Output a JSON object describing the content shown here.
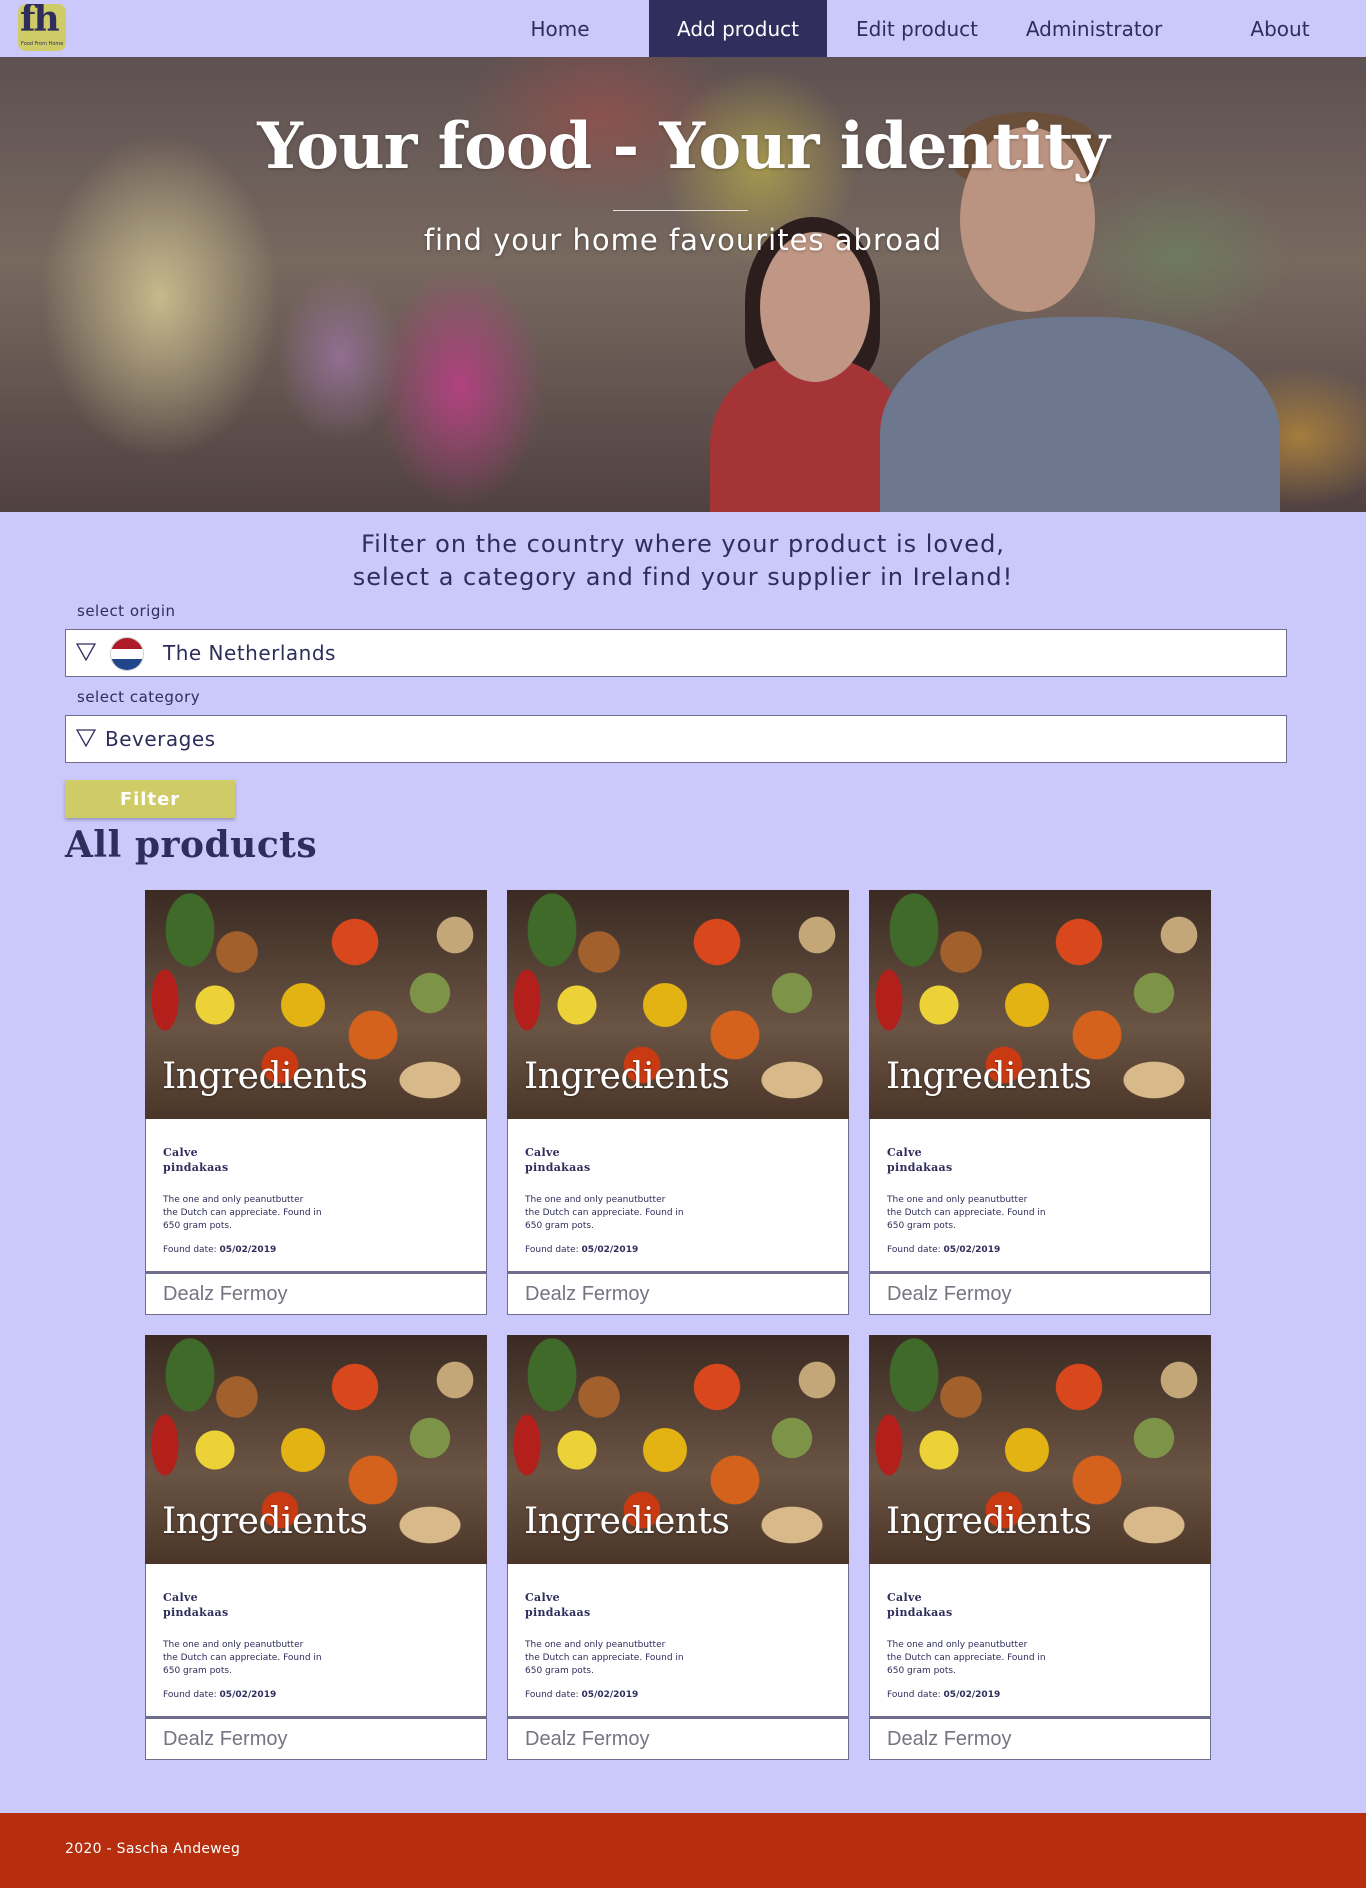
{
  "brand": {
    "mark": "fh",
    "tagline": "Food From Home"
  },
  "nav": {
    "items": [
      {
        "label": "Home"
      },
      {
        "label": "Add product"
      },
      {
        "label": "Edit product"
      },
      {
        "label": "Administrator"
      },
      {
        "label": "About"
      }
    ],
    "active": "Add product"
  },
  "hero": {
    "title": "Your food - Your identity",
    "subtitle": "find your home favourites abroad"
  },
  "filter": {
    "intro_line1": "Filter on the country where your product is loved,",
    "intro_line2": "select a category and find your supplier in Ireland!",
    "origin_label": "select origin",
    "origin_value": "The Netherlands",
    "origin_flag_colors": [
      "#ae1c28",
      "#ffffff",
      "#21468b"
    ],
    "category_label": "select category",
    "category_value": "Beverages",
    "button_label": "Filter",
    "dropdown_icon": "triangle-down-icon"
  },
  "products": {
    "title": "All products",
    "items": [
      {
        "category": "Ingredients",
        "name_line1": "Calve",
        "name_line2": "pindakaas",
        "desc_line1": "The one and only peanutbutter",
        "desc_line2": "the Dutch can appreciate. Found in",
        "desc_line3": "650 gram pots.",
        "date_label": "Found date:",
        "date": "05/02/2019",
        "store": "Dealz Fermoy"
      },
      {
        "category": "Ingredients",
        "name_line1": "Calve",
        "name_line2": "pindakaas",
        "desc_line1": "The one and only peanutbutter",
        "desc_line2": "the Dutch can appreciate. Found in",
        "desc_line3": "650 gram pots.",
        "date_label": "Found date:",
        "date": "05/02/2019",
        "store": "Dealz Fermoy"
      },
      {
        "category": "Ingredients",
        "name_line1": "Calve",
        "name_line2": "pindakaas",
        "desc_line1": "The one and only peanutbutter",
        "desc_line2": "the Dutch can appreciate. Found in",
        "desc_line3": "650 gram pots.",
        "date_label": "Found date:",
        "date": "05/02/2019",
        "store": "Dealz Fermoy"
      },
      {
        "category": "Ingredients",
        "name_line1": "Calve",
        "name_line2": "pindakaas",
        "desc_line1": "The one and only peanutbutter",
        "desc_line2": "the Dutch can appreciate. Found in",
        "desc_line3": "650 gram pots.",
        "date_label": "Found date:",
        "date": "05/02/2019",
        "store": "Dealz Fermoy"
      },
      {
        "category": "Ingredients",
        "name_line1": "Calve",
        "name_line2": "pindakaas",
        "desc_line1": "The one and only peanutbutter",
        "desc_line2": "the Dutch can appreciate. Found in",
        "desc_line3": "650 gram pots.",
        "date_label": "Found date:",
        "date": "05/02/2019",
        "store": "Dealz Fermoy"
      },
      {
        "category": "Ingredients",
        "name_line1": "Calve",
        "name_line2": "pindakaas",
        "desc_line1": "The one and only peanutbutter",
        "desc_line2": "the Dutch can appreciate. Found in",
        "desc_line3": "650 gram pots.",
        "date_label": "Found date:",
        "date": "05/02/2019",
        "store": "Dealz Fermoy"
      }
    ]
  },
  "footer": {
    "text": "2020 - Sascha Andeweg"
  },
  "colors": {
    "page_bg": "#cbc8fb",
    "nav_active": "#2f2e5c",
    "accent": "#cfcc68",
    "footer": "#b62e0d",
    "text": "#2e2d5b"
  }
}
